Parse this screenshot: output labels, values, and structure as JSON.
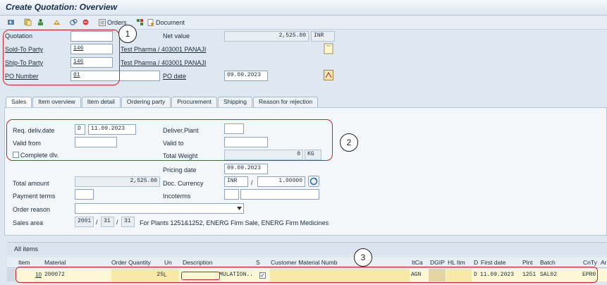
{
  "window": {
    "title": "Create Quotation: Overview"
  },
  "toolbar": {
    "orders_label": "Orders",
    "document_label": "Document"
  },
  "header": {
    "quotation_label": "Quotation",
    "quotation_value": "",
    "net_value_label": "Net value",
    "net_value": "2,525.00",
    "net_currency": "INR",
    "sold_to_label": "Sold-To Party",
    "sold_to_value": "146",
    "sold_to_desc": "Test Pharma / 403001 PANAJI",
    "ship_to_label": "Ship-To Party",
    "ship_to_value": "146",
    "ship_to_desc": "Test Pharma / 403001 PANAJI",
    "po_number_label": "PO Number",
    "po_number_value": "01",
    "po_date_label": "PO date",
    "po_date_value": "09.09.2023"
  },
  "tabs": [
    "Sales",
    "Item overview",
    "Item detail",
    "Ordering party",
    "Procurement",
    "Shipping",
    "Reason for rejection"
  ],
  "sales": {
    "req_deliv_label": "Req. deliv.date",
    "req_deliv_type": "D",
    "req_deliv_value": "11.09.2023",
    "deliver_plant_label": "Deliver.Plant",
    "deliver_plant_value": "",
    "valid_from_label": "Valid from",
    "valid_from_value": "",
    "valid_to_label": "Valid to",
    "valid_to_value": "",
    "complete_dlv_label": "Complete dlv.",
    "total_weight_label": "Total Weight",
    "total_weight_value": "0",
    "total_weight_unit": "KG",
    "pricing_date_label": "Pricing date",
    "pricing_date_value": "09.09.2023",
    "total_amount_label": "Total amount",
    "total_amount_value": "2,525.00",
    "doc_currency_label": "Doc. Currency",
    "doc_currency_value": "INR",
    "slash": "/",
    "exchange_rate": "1.00000",
    "payment_terms_label": "Payment terms",
    "payment_terms_value": "",
    "incoterms_label": "Incoterms",
    "incoterms_value": "",
    "incoterms_desc": "",
    "order_reason_label": "Order reason",
    "order_reason_value": "",
    "sales_area_label": "Sales area",
    "sales_org": "2001",
    "dist_channel": "31",
    "division": "31",
    "sales_area_desc": "For Plants 1251&1252, ENERG Firm Sale, ENERG Firm Medicines"
  },
  "items": {
    "header_label": "All items",
    "columns": [
      "Item",
      "Material",
      "Order Quantity",
      "Un",
      "Description",
      "S",
      "Customer Material Numb",
      "ItCa",
      "DGIP",
      "HL Itm",
      "D",
      "First date",
      "Plnt",
      "Batch",
      "CnTy",
      "Ar"
    ],
    "rows": [
      {
        "item": "10",
        "material": "200072",
        "qty": "25",
        "unit": "L",
        "description": "RMULATION..",
        "item_cat": "AGN",
        "date_type": "D",
        "first_date": "11.09.2023",
        "plant": "1251",
        "batch": "SAL02",
        "cond_type": "EPR0"
      }
    ]
  },
  "callouts": [
    "1",
    "2",
    "3"
  ],
  "colors": {
    "highlight": "#c9242b",
    "row_bg": "#fdf7d6"
  }
}
